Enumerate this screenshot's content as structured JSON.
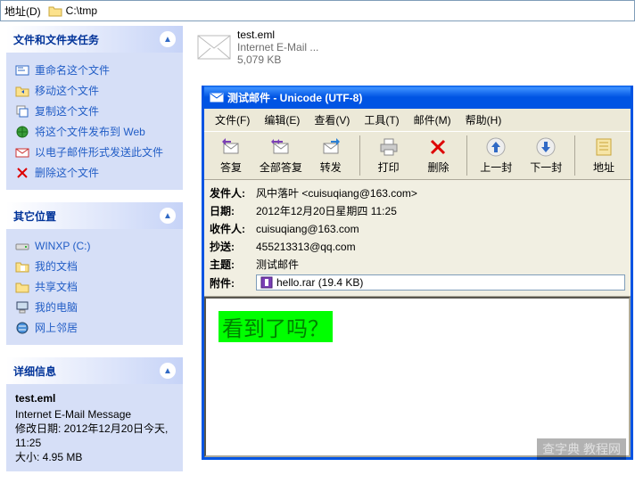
{
  "addrbar": {
    "label": "地址(D)",
    "path": "C:\\tmp"
  },
  "panels": {
    "tasks": {
      "title": "文件和文件夹任务",
      "items": [
        {
          "label": "重命名这个文件",
          "icon": "rename-icon"
        },
        {
          "label": "移动这个文件",
          "icon": "move-icon"
        },
        {
          "label": "复制这个文件",
          "icon": "copy-icon"
        },
        {
          "label": "将这个文件发布到 Web",
          "icon": "publish-icon"
        },
        {
          "label": "以电子邮件形式发送此文件",
          "icon": "email-icon"
        },
        {
          "label": "删除这个文件",
          "icon": "delete-icon"
        }
      ]
    },
    "places": {
      "title": "其它位置",
      "items": [
        {
          "label": "WINXP (C:)",
          "icon": "drive-icon"
        },
        {
          "label": "我的文档",
          "icon": "mydocs-icon"
        },
        {
          "label": "共享文档",
          "icon": "shared-icon"
        },
        {
          "label": "我的电脑",
          "icon": "computer-icon"
        },
        {
          "label": "网上邻居",
          "icon": "network-icon"
        }
      ]
    },
    "details": {
      "title": "详细信息",
      "filename": "test.eml",
      "filetype": "Internet E-Mail Message",
      "modified_label": "修改日期: 2012年12月20日今天, 11:25",
      "size_label": "大小: 4.95 MB"
    }
  },
  "file": {
    "name": "test.eml",
    "type": "Internet E-Mail ...",
    "size": "5,079 KB"
  },
  "mail": {
    "title": "测试邮件 - Unicode (UTF-8)",
    "menus": {
      "file": "文件(F)",
      "edit": "编辑(E)",
      "view": "查看(V)",
      "tools": "工具(T)",
      "message": "邮件(M)",
      "help": "帮助(H)"
    },
    "toolbar": {
      "reply": "答复",
      "replyall": "全部答复",
      "forward": "转发",
      "print": "打印",
      "delete": "删除",
      "prev": "上一封",
      "next": "下一封",
      "address": "地址"
    },
    "headers": {
      "from_label": "发件人:",
      "from_value": "风中落叶 <cuisuqiang@163.com>",
      "date_label": "日期:",
      "date_value": "2012年12月20日星期四 11:25",
      "to_label": "收件人:",
      "to_value": "cuisuqiang@163.com",
      "cc_label": "抄送:",
      "cc_value": "455213313@qq.com",
      "subject_label": "主题:",
      "subject_value": "测试邮件",
      "attach_label": "附件:",
      "attach_value": "hello.rar (19.4 KB)"
    },
    "body_text": "看到了吗？"
  },
  "watermark": "查字典 教程网"
}
